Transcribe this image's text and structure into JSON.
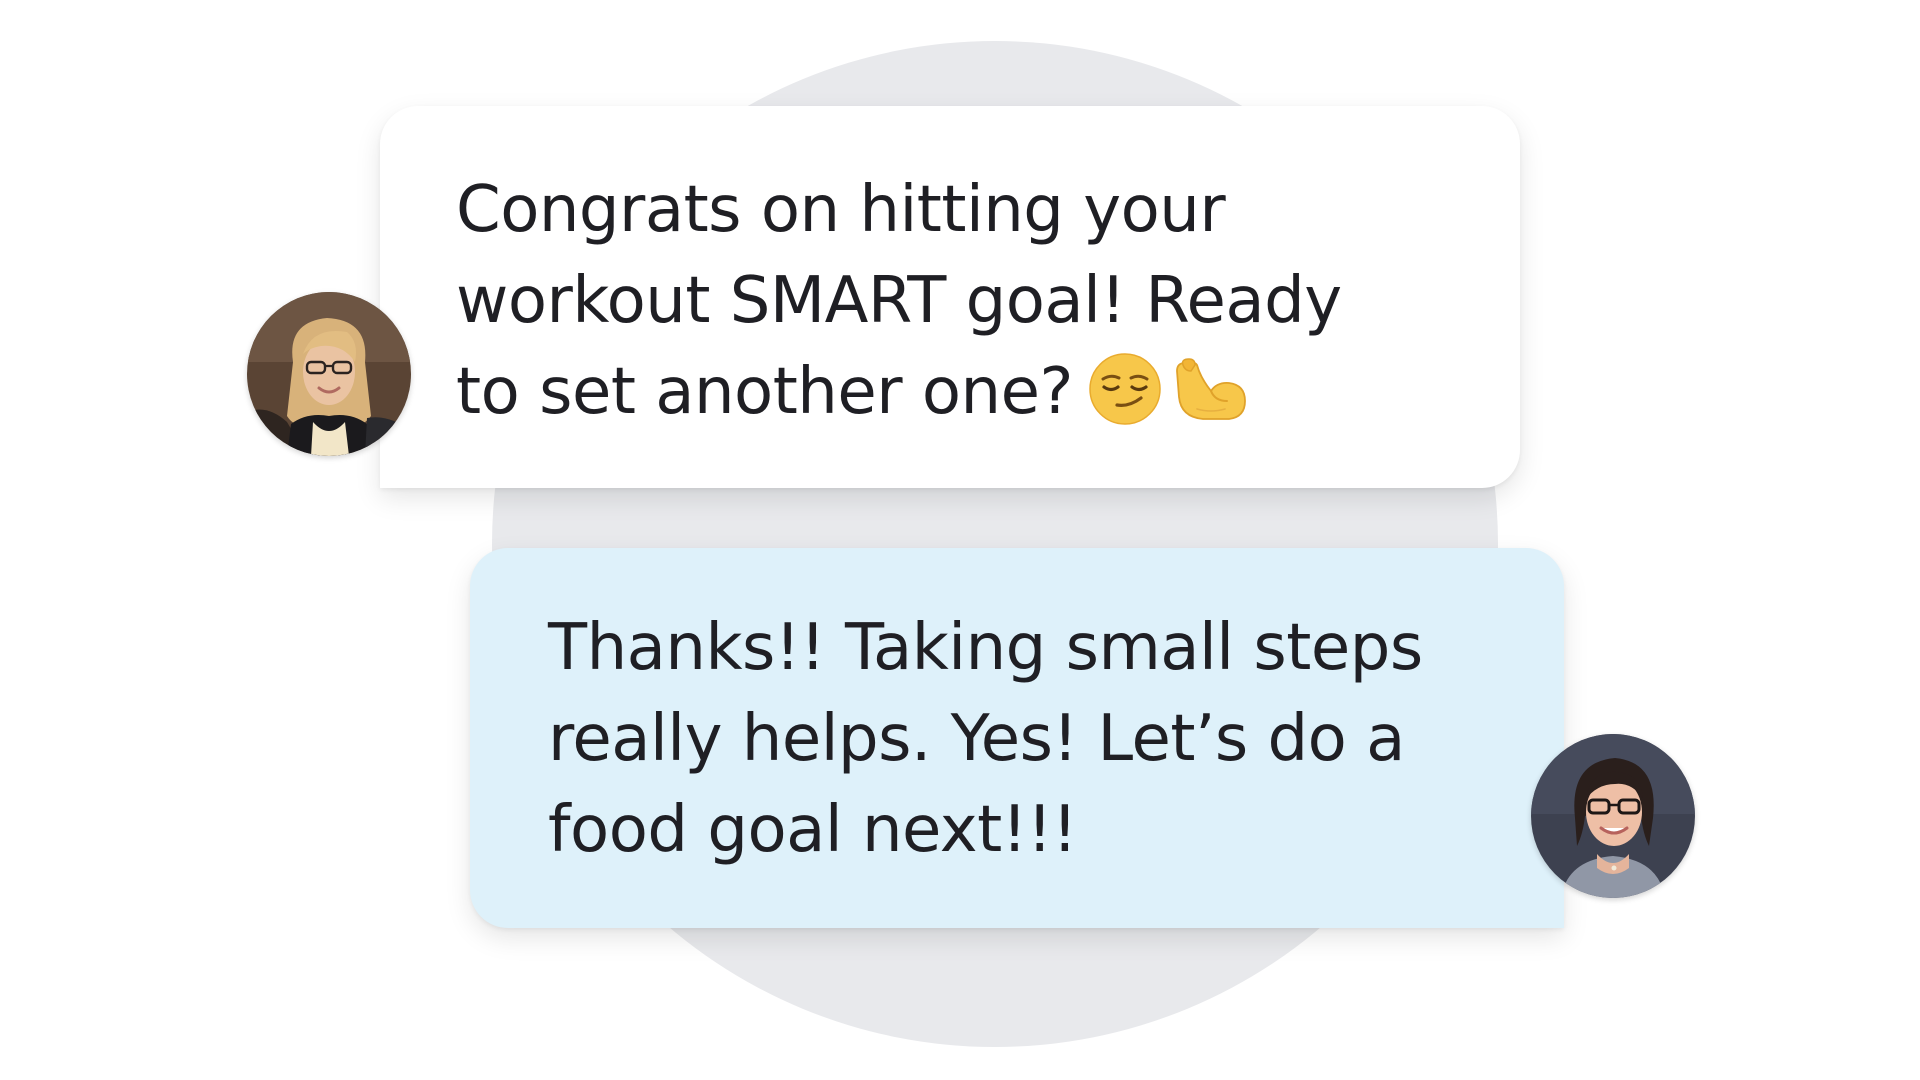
{
  "conversation": {
    "messages": [
      {
        "sender": "coach",
        "lines": [
          "Congrats on hitting your",
          "workout SMART goal! Ready",
          "to set another one?"
        ],
        "emojis": [
          "smirking-face-icon",
          "flexed-biceps-icon"
        ]
      },
      {
        "sender": "user",
        "lines": [
          "Thanks!! Taking small steps",
          "really helps. Yes! Let’s do a",
          "food goal next!!!"
        ]
      }
    ]
  },
  "colors": {
    "page_background": "#ffffff",
    "backdrop_circle": "#e8e9ec",
    "coach_bubble": "#ffffff",
    "user_bubble": "#def1fa",
    "text": "#1f1f24"
  }
}
